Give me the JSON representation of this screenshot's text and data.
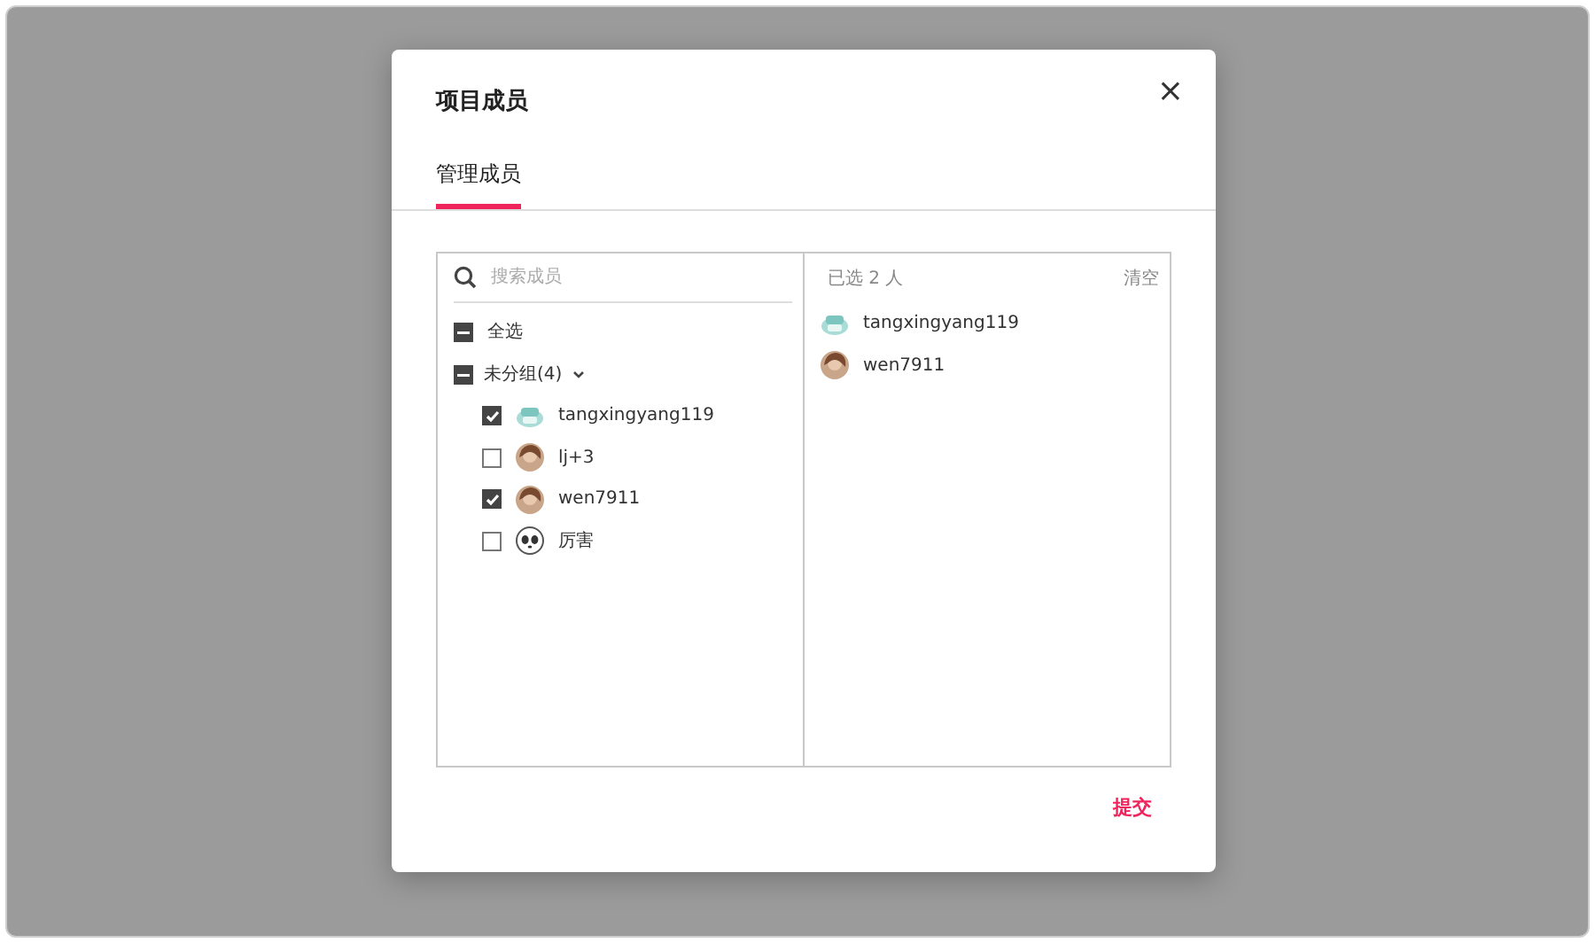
{
  "dialog": {
    "title": "项目成员",
    "close": "×"
  },
  "tabs": [
    {
      "label": "管理成员",
      "selected": true
    }
  ],
  "search": {
    "placeholder": "搜索成员"
  },
  "select_all": {
    "label": "全选",
    "indeterminate": true
  },
  "group": {
    "label": "未分组(4)",
    "indeterminate": true,
    "expanded": true
  },
  "members": [
    {
      "name": "tangxingyang119",
      "checked": true,
      "kind": "robot"
    },
    {
      "name": "lj+3",
      "checked": false,
      "kind": "photo"
    },
    {
      "name": "wen7911",
      "checked": true,
      "kind": "photo"
    },
    {
      "name": "厉害",
      "checked": false,
      "kind": "panda"
    }
  ],
  "selected_panel": {
    "count": "已选 2 人",
    "clear": "清空",
    "members": [
      {
        "name": "tangxingyang119",
        "kind": "robot"
      },
      {
        "name": "wen7911",
        "kind": "photo"
      }
    ]
  },
  "submit": "提交"
}
